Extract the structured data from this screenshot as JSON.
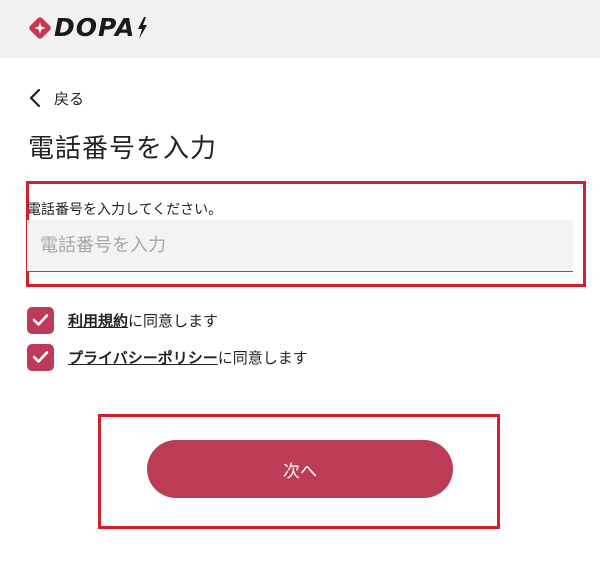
{
  "header": {
    "logo_text": "DOPA",
    "colors": {
      "bar": "#f1f1f1",
      "logo_mark": "#c83a52"
    }
  },
  "nav": {
    "back_label": "戻る",
    "back_icon": "chevron-left-icon"
  },
  "page": {
    "title": "電話番号を入力"
  },
  "phone_form": {
    "label": "電話番号を入力してください。",
    "placeholder": "電話番号を入力",
    "value": ""
  },
  "agreements": {
    "terms": {
      "link": "利用規約",
      "suffix": "に同意します",
      "checked": true
    },
    "privacy": {
      "link": "プライバシーポリシー",
      "suffix": "に同意します",
      "checked": true
    }
  },
  "actions": {
    "next_label": "次へ"
  },
  "colors": {
    "accent": "#bc3c56",
    "highlight_border": "#d0202c"
  }
}
